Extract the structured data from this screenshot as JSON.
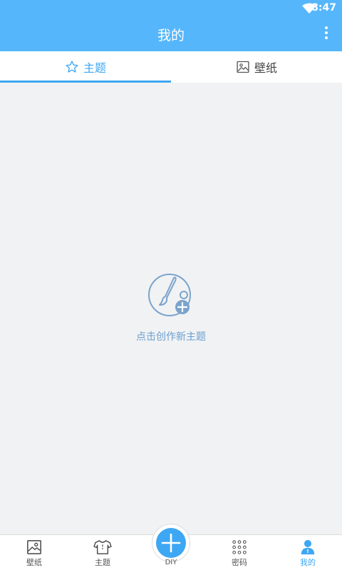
{
  "status_bar": {
    "time": "8:47"
  },
  "app_bar": {
    "title": "我的"
  },
  "tabs": [
    {
      "label": "主题",
      "icon": "star-icon",
      "active": true
    },
    {
      "label": "壁纸",
      "icon": "image-icon",
      "active": false
    }
  ],
  "empty_state": {
    "text": "点击创作新主题",
    "icon": "brush-add-icon"
  },
  "bottom_nav": {
    "items": [
      {
        "label": "壁纸",
        "icon": "wallpaper-icon"
      },
      {
        "label": "主题",
        "icon": "shirt-icon"
      },
      {
        "label": "DIY",
        "icon": "plus-icon"
      },
      {
        "label": "密码",
        "icon": "keypad-icon"
      },
      {
        "label": "我的",
        "icon": "person-icon",
        "active": true
      }
    ]
  },
  "colors": {
    "accent": "#3ea7f3",
    "app_bar": "#55b6fb",
    "background": "#f1f2f4"
  }
}
